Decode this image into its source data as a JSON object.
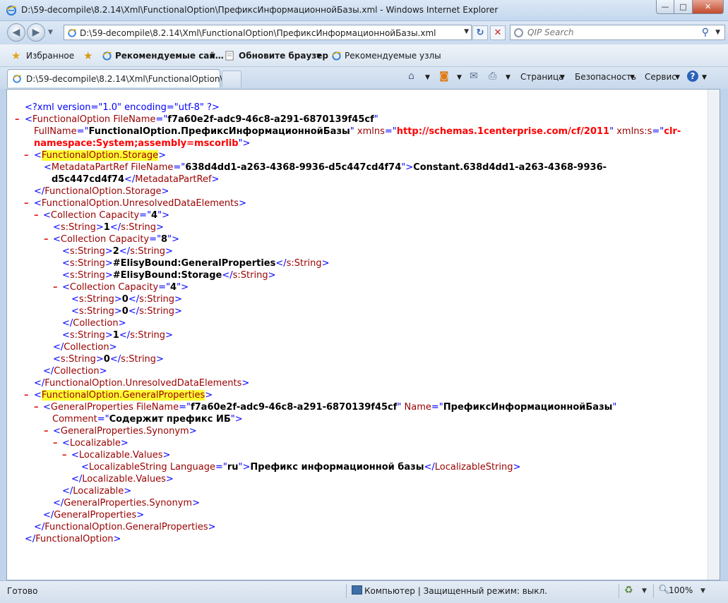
{
  "window": {
    "title": "D:\\59-decompile\\8.2.14\\Xml\\FunctionalOption\\ПрефиксИнформационнойБазы.xml - Windows Internet Explorer",
    "min_label": "—",
    "max_label": "□",
    "close_label": "✕"
  },
  "nav": {
    "address": "D:\\59-decompile\\8.2.14\\Xml\\FunctionalOption\\ПрефиксИнформационнойБазы.xml",
    "search_placeholder": "QIP Search"
  },
  "favorites": {
    "label": "Избранное",
    "items": [
      "Рекомендуемые сай…",
      "Обновите браузер",
      "Рекомендуемые узлы"
    ]
  },
  "tab": {
    "label": "D:\\59-decompile\\8.2.14\\Xml\\FunctionalOption\\..."
  },
  "commands": {
    "page": "Страница",
    "safety": "Безопасность",
    "tools": "Сервис",
    "help": "?"
  },
  "xml": {
    "decl": "<?xml version=\"1.0\" encoding=\"utf-8\" ?>",
    "fo_name": "FunctionalOption",
    "fo_attr_filename": "FileName",
    "fo_filename": "f7a60e2f-adc9-46c8-a291-6870139f45cf",
    "fo_attr_fullname": "FullName",
    "fo_fullname": "FunctionalOption.ПрефиксИнформационнойБазы",
    "xmlns_attr": "xmlns",
    "xmlns_val": "http://schemas.1centerprise.com/cf/2011",
    "xmlns_s_attr": "xmlns:s",
    "xmlns_s_val_1": "clr-",
    "xmlns_s_val_2": "namespace:System;assembly=mscorlib",
    "storage": "FunctionalOption.Storage",
    "mdref": "MetadataPartRef",
    "mdref_attr": "FileName",
    "mdref_filename": "638d4dd1-a263-4368-9936-d5c447cd4f74",
    "mdref_text_1": "Constant.638d4dd1-a263-4368-9936-",
    "mdref_text_2": "d5c447cd4f74",
    "unresolved": "FunctionalOption.UnresolvedDataElements",
    "collection": "Collection",
    "capacity_attr": "Capacity",
    "cap4": "4",
    "cap8": "8",
    "sstring": "s:String",
    "v1": "1",
    "v2": "2",
    "v_general": "#ElisyBound:GeneralProperties",
    "v_storage": "#ElisyBound:Storage",
    "v0": "0",
    "general": "FunctionalOption.GeneralProperties",
    "gp": "GeneralProperties",
    "gp_attr_filename": "FileName",
    "gp_filename": "f7a60e2f-adc9-46c8-a291-6870139f45cf",
    "gp_attr_name": "Name",
    "gp_name": "ПрефиксИнформационнойБазы",
    "gp_attr_comment": "Comment",
    "gp_comment": "Содержит префикс ИБ",
    "synonym": "GeneralProperties.Synonym",
    "localizable": "Localizable",
    "loc_values": "Localizable.Values",
    "locstring": "LocalizableString",
    "lang_attr": "Language",
    "lang": "ru",
    "loc_text": "Префикс информационной базы"
  },
  "status": {
    "text": "Готово",
    "zone": "Компьютер | Защищенный режим: выкл.",
    "zoom": "100%"
  },
  "colors": {
    "tag": "#990000",
    "bracket": "#0000ff",
    "highlight": "#ffff33",
    "minus": "#e01c1c"
  }
}
